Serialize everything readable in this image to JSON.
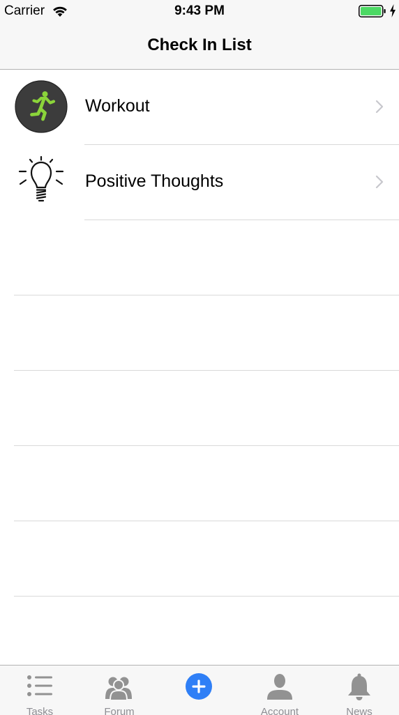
{
  "status_bar": {
    "carrier": "Carrier",
    "time": "9:43 PM",
    "battery_color": "#4cd964"
  },
  "nav": {
    "title": "Check In List"
  },
  "list": {
    "items": [
      {
        "label": "Workout",
        "icon": "running-person-icon",
        "icon_color": "#8bd43a"
      },
      {
        "label": "Positive Thoughts",
        "icon": "lightbulb-icon"
      }
    ]
  },
  "tab_bar": {
    "accent": "#2f7ff6",
    "inactive_color": "#8e8e93",
    "tabs": [
      {
        "label": "Tasks",
        "icon": "list-icon"
      },
      {
        "label": "Forum",
        "icon": "group-icon"
      },
      {
        "label": "",
        "icon": "add-icon"
      },
      {
        "label": "Account",
        "icon": "person-icon"
      },
      {
        "label": "News",
        "icon": "bell-icon"
      }
    ]
  }
}
